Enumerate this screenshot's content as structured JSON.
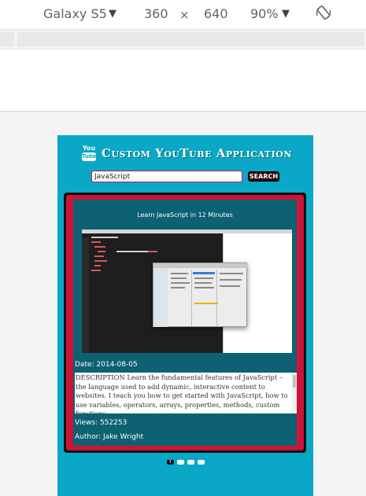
{
  "devtools": {
    "device": "Galaxy S5",
    "width": "360",
    "times": "×",
    "height": "640",
    "zoom": "90%",
    "arrow": "▼"
  },
  "app": {
    "title": "Custom YouTube Application",
    "logo_top": "You",
    "logo_bottom": "Tube"
  },
  "search": {
    "value": "JavaScript",
    "button_label": "SEARCH"
  },
  "video": {
    "title": "Learn JavaScript in 12 Minutes",
    "date": "Date: 2014-08-05",
    "description": "DESCRIPTION Learn the fundamental features of JavaScript – the language used to add dynamic, interactive content to websites. I teach you how to get started with JavaScript, how to use variables, operators, arrays, properties, methods, custom functions,",
    "views": "Views: 552253",
    "author": "Author: Jake Wright"
  },
  "pager": {
    "pages": [
      "1",
      "",
      "",
      ""
    ],
    "active": 0
  },
  "colors": {
    "app_background": "#0aa8c6",
    "card_background": "#0d6173",
    "card_border": "#cc1438",
    "input_border": "#c2185b"
  },
  "icons": {
    "rotate": "rotate-icon",
    "youtube_logo": "youtube-logo-icon"
  }
}
